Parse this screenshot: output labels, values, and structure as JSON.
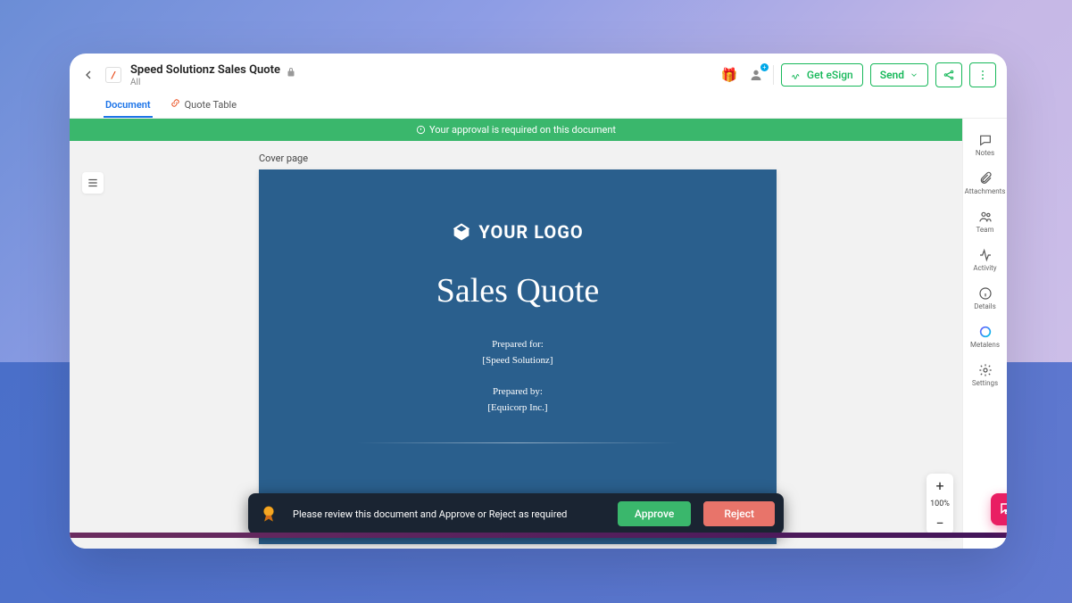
{
  "header": {
    "title": "Speed Solutionz Sales Quote",
    "subtitle": "All",
    "logo_char": "/",
    "buttons": {
      "esign": "Get eSign",
      "send": "Send"
    }
  },
  "tabs": {
    "document": "Document",
    "quote_table": "Quote Table"
  },
  "banner": {
    "approval_text": "Your approval is required on this document"
  },
  "document": {
    "page_label": "Cover page",
    "logo_text": "YOUR LOGO",
    "title": "Sales Quote",
    "prepared_for_label": "Prepared for:",
    "prepared_for_value": "[Speed Solutionz]",
    "prepared_by_label": "Prepared by:",
    "prepared_by_value": "[Equicorp Inc.]"
  },
  "review_bar": {
    "text": "Please review this document and Approve or Reject as required",
    "approve": "Approve",
    "reject": "Reject"
  },
  "zoom": {
    "level": "100%"
  },
  "right_rail": {
    "notes": "Notes",
    "attachments": "Attachments",
    "team": "Team",
    "activity": "Activity",
    "details": "Details",
    "metalens": "Metalens",
    "settings": "Settings"
  },
  "colors": {
    "primary_green": "#3ab76c",
    "cover_bg": "#2a5f8d",
    "reject_red": "#e8746a",
    "chat_pink": "#e91e63"
  }
}
